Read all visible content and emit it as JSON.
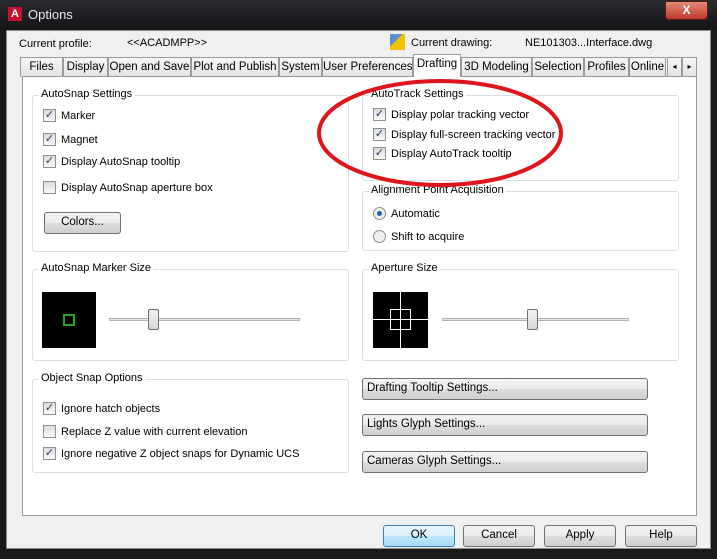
{
  "window": {
    "title": "Options",
    "close_label": "X"
  },
  "header": {
    "profile_label": "Current profile:",
    "profile_value": "<<ACADMPP>>",
    "drawing_label": "Current drawing:",
    "drawing_value": "NE101303...Interface.dwg"
  },
  "tabs": [
    {
      "label": "Files"
    },
    {
      "label": "Display"
    },
    {
      "label": "Open and Save"
    },
    {
      "label": "Plot and Publish"
    },
    {
      "label": "System"
    },
    {
      "label": "User Preferences"
    },
    {
      "label": "Drafting",
      "active": true
    },
    {
      "label": "3D Modeling"
    },
    {
      "label": "Selection"
    },
    {
      "label": "Profiles"
    },
    {
      "label": "Online"
    }
  ],
  "autosnap": {
    "title": "AutoSnap Settings",
    "items": [
      {
        "label": "Marker",
        "checked": true
      },
      {
        "label": "Magnet",
        "checked": true
      },
      {
        "label": "Display AutoSnap tooltip",
        "checked": true
      },
      {
        "label": "Display AutoSnap aperture box",
        "checked": false
      }
    ],
    "colors_button": "Colors..."
  },
  "autotrack": {
    "title": "AutoTrack Settings",
    "items": [
      {
        "label": "Display polar tracking vector",
        "checked": true
      },
      {
        "label": "Display full-screen tracking vector",
        "checked": true
      },
      {
        "label": "Display AutoTrack tooltip",
        "checked": true
      }
    ],
    "highlight_color": "#e0141c"
  },
  "alignment": {
    "title": "Alignment Point Acquisition",
    "options": [
      {
        "label": "Automatic",
        "selected": true
      },
      {
        "label": "Shift to acquire",
        "selected": false
      }
    ]
  },
  "marker_size": {
    "title": "AutoSnap Marker Size",
    "slider_percent": 23,
    "marker_color": "#1fa81f"
  },
  "aperture_size": {
    "title": "Aperture Size",
    "slider_percent": 48
  },
  "object_snap": {
    "title": "Object Snap Options",
    "items": [
      {
        "label": "Ignore hatch objects",
        "checked": true
      },
      {
        "label": "Replace Z value with current elevation",
        "checked": false
      },
      {
        "label": "Ignore negative Z object snaps for Dynamic UCS",
        "checked": true
      }
    ]
  },
  "settings_buttons": {
    "drafting_tooltip": "Drafting Tooltip Settings...",
    "lights_glyph": "Lights Glyph Settings...",
    "cameras_glyph": "Cameras Glyph Settings..."
  },
  "footer": {
    "ok": "OK",
    "cancel": "Cancel",
    "apply": "Apply",
    "help": "Help"
  }
}
